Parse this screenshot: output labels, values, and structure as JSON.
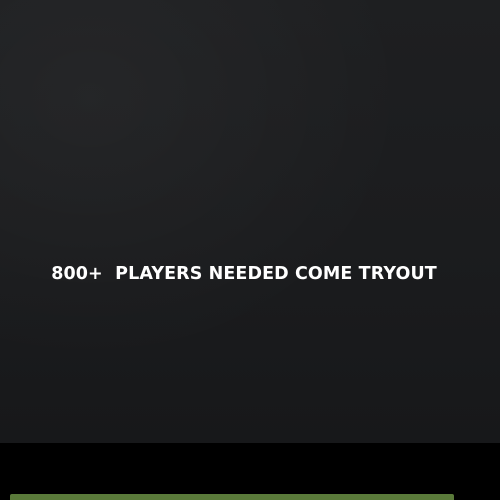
{
  "hero": {
    "headline": "800+  PLAYERS NEEDED COME TRYOUT"
  },
  "colors": {
    "background": "#1c1d1f",
    "footer": "#000000",
    "accent": "#5a7a3a",
    "text": "#ffffff"
  }
}
